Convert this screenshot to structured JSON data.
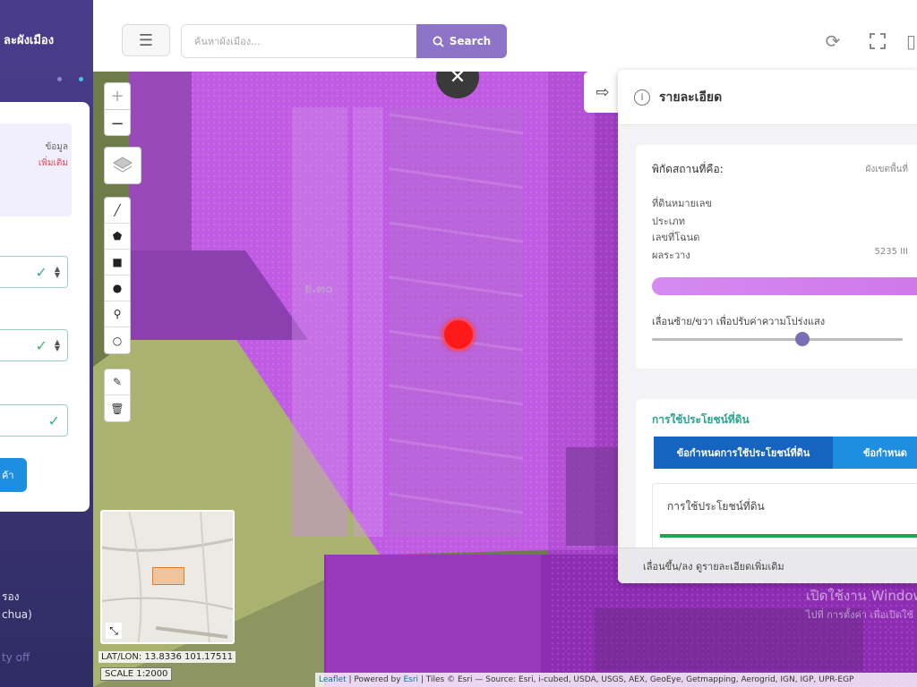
{
  "sidebar": {
    "title": "ละผังเมือง",
    "note_line1": "ข้อมูล",
    "note_line2": "เพิ่มเติม",
    "button_label": "ค้า",
    "footer_line1": "รอง",
    "footer_line2": "chua)",
    "footer_line3": "ty off",
    "colors": {
      "accent": "#1e8ee0",
      "background": "#3c3576"
    }
  },
  "topbar": {
    "search_placeholder": "ค้นหาผังเมือง...",
    "search_button_label": "Search",
    "icons": [
      "menu-icon",
      "search-icon",
      "refresh-icon",
      "fullscreen-icon",
      "print-icon"
    ],
    "accent_color": "#8e74c9"
  },
  "map": {
    "zoom_in": "+",
    "zoom_out": "−",
    "zone_code": "ย.๓๐",
    "close_glyph": "✕",
    "minimap_label": "ย.๓๐",
    "coords_text": "LAT/LON: 13.8336    101.17511",
    "scale_text": "SCALE 1:2000",
    "attribution_leaflet": "Leaflet",
    "attribution_text": " | Powered by ",
    "attribution_esri": "Esri",
    "attribution_rest": " | Tiles © Esri — Source: Esri, i-cubed, USDA, USGS, AEX, GeoEye, Getmapping, Aerogrid, IGN, IGP, UPR-EGP",
    "watermark_title": "เปิดใช้งาน Windows",
    "watermark_sub": "ไปที่ การตั้งค่า เพื่อเปิดใช้",
    "colors": {
      "zone_residential": "#c15be3",
      "zone_agri": "#a9b36f",
      "marker": "#ff1a1a"
    }
  },
  "panel": {
    "title": "รายละเอียด",
    "coord_label": "พิกัดสถานที่คือ:",
    "coord_value": "ผังเขตพื้นที่",
    "rows": [
      {
        "label": "ที่ดินหมายเลข",
        "value": ""
      },
      {
        "label": "ประเภท",
        "value": ""
      },
      {
        "label": "เลขที่โฉนด",
        "value": ""
      },
      {
        "label": "ผลระวาง",
        "value": "5235 III"
      }
    ],
    "opacity_label": "เลื่อนซ้าย/ขวา เพื่อปรับค่าความโปร่งแสง",
    "opacity_value": 0.6,
    "landuse_heading": "การใช้ประโยชน์ที่ดิน",
    "tab_active": "ข้อกำหนดการใช้ประโยชน์ที่ดิน",
    "tab_other": "ข้อกำหนด",
    "subcard_title": "การใช้ประโยชน์ที่ดิน",
    "footer_text": "เลื่อนขึ้น/ลง ดูรายละเอียดเพิ่มเติม",
    "colors": {
      "tab_active": "#1565c0",
      "tab_other": "#1e8ee0",
      "heading": "#28a58f",
      "bar": "#d58af0"
    }
  }
}
